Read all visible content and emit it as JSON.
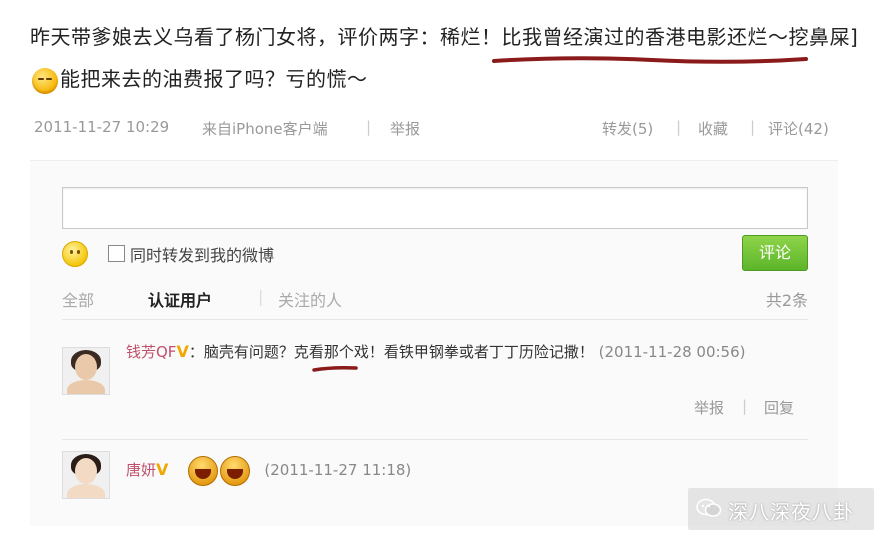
{
  "post": {
    "text_part1": "昨天带爹娘去义乌看了杨门女将，评价两字：稀烂！比我曾经演过的香港电影还烂～挖鼻屎]",
    "text_part2": "能把来去的油费报了吗？亏的慌～",
    "emoji_icon": "shy-face-icon"
  },
  "meta": {
    "time": "2011-11-27 10:29",
    "source": "来自iPhone客户端",
    "report": "举报",
    "forward": "转发(5)",
    "favorite": "收藏",
    "comment": "评论(42)"
  },
  "comment_form": {
    "input_value": "",
    "also_forward_label": "同时转发到我的微博",
    "submit_label": "评论"
  },
  "filters": {
    "all": "全部",
    "verified": "认证用户",
    "following": "关注的人",
    "count": "共2条"
  },
  "comments": [
    {
      "name": "钱芳QF",
      "text": "：脑壳有问题？克看那个戏！看铁甲钢拳或者丁丁历险记撒！",
      "time": "(2011-11-28 00:56)",
      "report": "举报",
      "reply": "回复"
    },
    {
      "name": "唐妍",
      "time": "(2011-11-27 11:18)"
    }
  ],
  "watermark": {
    "text": "深八深夜八卦"
  },
  "colors": {
    "annotation_red": "#8b1a1a",
    "submit_green": "#5cb52a",
    "name_pink": "#c0506c"
  }
}
